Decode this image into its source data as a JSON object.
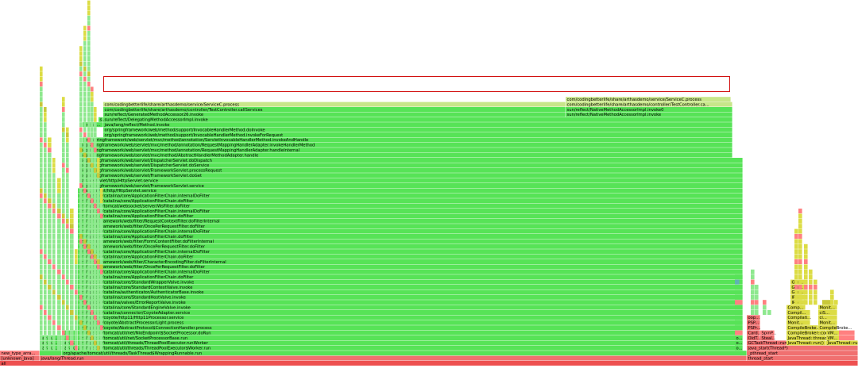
{
  "flamegraph": {
    "colors": {
      "green": "#57e357",
      "green_light": "#8ee88e",
      "selected": "#c8e68a",
      "red": "#f07070",
      "red_light": "#ff8080",
      "yellow": "#dcdc44",
      "yellow_dark": "#c8c83a",
      "teal": "#5fb3b3",
      "root": "#ee5050"
    },
    "labels": {
      "root": "all",
      "unknown_java": "[unknown_Java]",
      "thread_run": "java/lang/Thread.run",
      "wrapping_runnable": "org/apache/tomcat/util/threads/TaskThread$WrappingRunnable.run",
      "tpe_worker_run": "org/apache/tomcat/util/threads/ThreadPoolExecutor$Worker.run",
      "tpe_run_worker": "org/apache/tomcat/util/threads/ThreadPoolExecutor.runWorker",
      "socket_processor_base": "org/apache/tomcat/util/net/SocketProcessorBase.run",
      "socket_processor_dorun": "org/apache/tomcat/util/net/NioEndpoint$SocketProcessor.doRun",
      "conn_handler_process": "org/apache/coyote/AbstractProtocol$ConnectionHandler.process",
      "abstract_processor_light": "org/apache/coyote/AbstractProcessorLight.process",
      "http11_service": "org/apache/coyote/http11/Http11Processor.service",
      "coyote_adapter": "org/apache/catalina/connector/CoyoteAdapter.service",
      "standard_engine": "org/apache/catalina/core/StandardEngineValve.invoke",
      "error_report": "org/apache/catalina/valves/ErrorReportValve.invoke",
      "standard_host": "org/apache/catalina/core/StandardHostValve.invoke",
      "authenticator": "org/apache/catalina/authenticator/AuthenticatorBase.invoke",
      "standard_context": "org/apache/catalina/core/StandardContextValve.invoke",
      "standard_wrapper": "org/apache/catalina/core/StandardWrapperValve.invoke",
      "afc_dofilter": "org/apache/catalina/core/ApplicationFilterChain.doFilter",
      "afc_internal": "org/apache/catalina/core/ApplicationFilterChain.internalDoFilter",
      "opr_dofilter": "org/springframework/web/filter/OncePerRequestFilter.doFilter",
      "char_encoding": "org/springframework/web/filter/CharacterEncodingFilter.doFilterInternal",
      "form_content": "org/springframework/web/filter/FormContentFilter.doFilterInternal",
      "request_context": "org/springframework/web/filter/RequestContextFilter.doFilterInternal",
      "wsfilter": "org/apache/tomcat/websocket/server/WsFilter.doFilter",
      "http_servlet_service": "javax/servlet/http/HttpServlet.service",
      "framework_service": "org/springframework/web/servlet/FrameworkServlet.service",
      "framework_doget": "org/springframework/web/servlet/FrameworkServlet.doGet",
      "framework_process_request": "org/springframework/web/servlet/FrameworkServlet.processRequest",
      "dispatcher_doservice": "org/springframework/web/servlet/DispatcherServlet.doService",
      "dispatcher_dodispatch": "org/springframework/web/servlet/DispatcherServlet.doDispatch",
      "abstract_handler_adapter": "org/springframework/web/servlet/mvc/method/AbstractHandlerMethodAdapter.handle",
      "rmha_handle_internal": "org/springframework/web/servlet/mvc/method/annotation/RequestMappingHandlerAdapter.handleInternal",
      "rmha_invoke_handler": "org/springframework/web/servlet/mvc/method/annotation/RequestMappingHandlerAdapter.invokeHandlerMethod",
      "servlet_invocable_invoke": "org/springframework/web/servlet/mvc/method/annotation/ServletInvocableHandlerMethod.invokeAndHandle",
      "invocable_for_request": "org/springframework/web/method/support/InvocableHandlerMethod.invokeForRequest",
      "invocable_do_invoke": "org/springframework/web/method/support/InvocableHandlerMethod.doInvoke",
      "method_invoke": "java/lang/reflect/Method.invoke",
      "delegating_accessor": "sun/reflect/DelegatingMethodAccessorImpl.invoke",
      "generated_accessor": "sun/reflect/GeneratedMethodAccessor26.invoke",
      "native_accessor": "sun/reflect/NativeMethodAccessorImpl.invoke",
      "native_accessor0": "sun/reflect/NativeMethodAccessorImpl.invoke0",
      "test_controller": "com/codingbetterlife/share/arthasdemo/controller/TestController.callServices",
      "test_controller_short": "com/codingbetterlife/share/arthasdemo/controller/TestController.ca...",
      "service_c_process": "com/codingbetterlife/share/arthasdemo/service/ServiceC.process",
      "java_start": "java_start(Thread*)",
      "pthread_start": "_pthread_start",
      "thread_start": "thread_start",
      "new_type_array": "new_type_arra...",
      "java_ut": "java/ut...",
      "java_short": "java/...",
      "j_short": "j...",
      "o_short": "o...",
      "org_short": "org/...",
      "org_sp": "org/sp...",
      "sun_short": "s...",
      "c_short": "C...",
      "oop": "oop...",
      "psp": "PSP...",
      "psps": "PSPr...",
      "card": "Card...",
      "spinp": "SpinP...",
      "oldt": "OldT...",
      "steal": "Steal...",
      "gc_task_thread": "GCTaskThread::run()",
      "java_thread_run": "JavaThread::run()",
      "java_thread_thread": "JavaThread::thread_...",
      "vm": "VM...",
      "compile_broker_comp": "CompileBroker::compi...",
      "compile_broker": "CompileBroke...",
      "monit": "Monit...",
      "compil": "Compil...",
      "compilati": "Compilati...",
      "comp": "Comp...",
      "irb": "IRB...",
      "irs": "IRS...",
      "gra": "Gra...",
      "ci": "ci...",
      "cis": "ciS..."
    }
  }
}
